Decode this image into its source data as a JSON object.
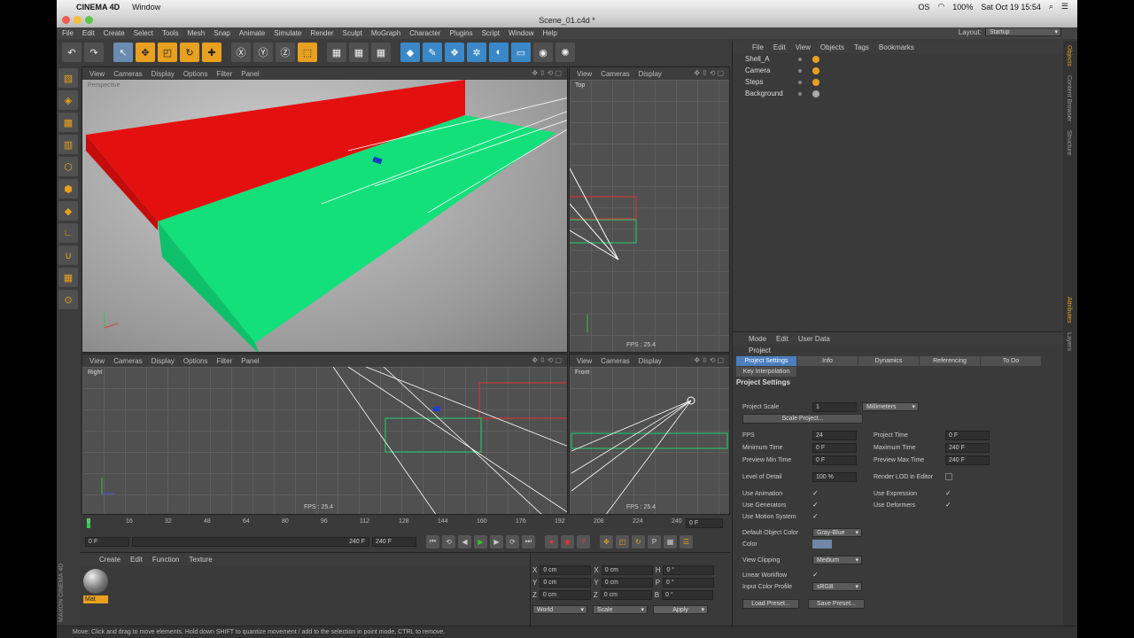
{
  "mac": {
    "app": "CINEMA 4D",
    "window_menu": "Window",
    "status_os": "OS",
    "battery": "100%",
    "clock": "Sat Oct 19  15:54"
  },
  "window": {
    "title": "Scene_01.c4d *"
  },
  "menubar": {
    "items": [
      "File",
      "Edit",
      "Create",
      "Select",
      "Tools",
      "Mesh",
      "Snap",
      "Animate",
      "Simulate",
      "Render",
      "Sculpt",
      "MoGraph",
      "Character",
      "Plugins",
      "Script",
      "Window",
      "Help"
    ],
    "layout_label": "Layout:",
    "layout_value": "Startup"
  },
  "viewports": {
    "perspective": {
      "menu": [
        "View",
        "Cameras",
        "Display",
        "Options",
        "Filter",
        "Panel"
      ],
      "label": "Perspective",
      "fps": "FPS : 25.4"
    },
    "top": {
      "menu": [
        "View",
        "Cameras",
        "Display"
      ],
      "label": "Top",
      "fps": "FPS : 25.4"
    },
    "right": {
      "menu": [
        "View",
        "Cameras",
        "Display",
        "Options",
        "Filter",
        "Panel"
      ],
      "label": "Right",
      "fps": "FPS : 25.4"
    },
    "front": {
      "menu": [
        "View",
        "Cameras",
        "Display"
      ],
      "label": "Front",
      "fps": "FPS : 25.4"
    }
  },
  "timeline": {
    "ticks": [
      "0",
      "16",
      "32",
      "48",
      "64",
      "80",
      "96",
      "112",
      "128",
      "144",
      "160",
      "176",
      "192",
      "208",
      "224",
      "240"
    ],
    "current": "0 F"
  },
  "transport": {
    "start": "0 F",
    "range_end": "240 F",
    "end": "240 F"
  },
  "materials": {
    "menu": [
      "Create",
      "Edit",
      "Function",
      "Texture"
    ],
    "mat_name": "Mat",
    "brand": "MAXON CINEMA 4D"
  },
  "coords": {
    "rows": [
      {
        "a": "X",
        "av": "0 cm",
        "b": "X",
        "bv": "0 cm",
        "c": "H",
        "cv": "0 °"
      },
      {
        "a": "Y",
        "av": "0 cm",
        "b": "Y",
        "bv": "0 cm",
        "c": "P",
        "cv": "0 °"
      },
      {
        "a": "Z",
        "av": "0 cm",
        "b": "Z",
        "bv": "0 cm",
        "c": "B",
        "cv": "0 °"
      }
    ],
    "mode1": "World",
    "mode2": "Scale",
    "apply": "Apply"
  },
  "objects": {
    "menu": [
      "File",
      "Edit",
      "View",
      "Objects",
      "Tags",
      "Bookmarks"
    ],
    "list": [
      "Shell_A",
      "Camera",
      "Steps",
      "Background"
    ]
  },
  "attributes": {
    "menu": [
      "Mode",
      "Edit",
      "User Data"
    ],
    "object": "Project",
    "tabs": [
      "Project Settings",
      "Info",
      "Dynamics",
      "Referencing",
      "To Do"
    ],
    "subtab": "Key Interpolation",
    "section": "Project Settings",
    "project_scale_label": "Project Scale",
    "project_scale_value": "1",
    "project_scale_unit": "Millimeters",
    "scale_project_btn": "Scale Project...",
    "fps_label": "FPS",
    "fps_value": "24",
    "project_time_label": "Project Time",
    "project_time_value": "0 F",
    "min_time_label": "Minimum Time",
    "min_time_value": "0 F",
    "max_time_label": "Maximum Time",
    "max_time_value": "240 F",
    "prev_min_label": "Preview Min Time",
    "prev_min_value": "0 F",
    "prev_max_label": "Preview Max Time",
    "prev_max_value": "240 F",
    "lod_label": "Level of Detail",
    "lod_value": "100 %",
    "render_lod_label": "Render LOD in Editor",
    "use_animation": "Use Animation",
    "use_expression": "Use Expression",
    "use_generators": "Use Generators",
    "use_deformers": "Use Deformers",
    "use_motion": "Use Motion System",
    "default_color_label": "Default Object Color",
    "default_color_value": "Gray-Blue",
    "color_label": "Color",
    "view_clipping_label": "View Clipping",
    "view_clipping_value": "Medium",
    "linear_workflow_label": "Linear Workflow",
    "input_profile_label": "Input Color Profile",
    "input_profile_value": "sRGB",
    "load_preset": "Load Preset...",
    "save_preset": "Save Preset..."
  },
  "side_tabs": [
    "Objects",
    "Content Browser",
    "Structure"
  ],
  "side_tabs_lower": [
    "Attributes",
    "Layers"
  ],
  "status": "Move: Click and drag to move elements. Hold down SHIFT to quantize movement / add to the selection in point mode, CTRL to remove.",
  "colors": {
    "red_box": "#e41010",
    "green_box": "#13e07a",
    "accent": "#e8a020",
    "tab_active": "#4a7fc0"
  }
}
